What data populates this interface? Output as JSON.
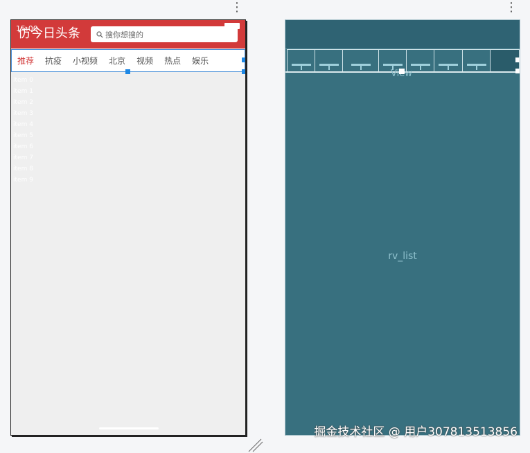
{
  "toolbar": {
    "more_icon": "more-vert-icon"
  },
  "phone": {
    "status_time": "15:00",
    "app_title": "仿今日头条",
    "search_placeholder": "搜你想搜的",
    "search_icon": "search-icon",
    "colors": {
      "header": "#d23a3a",
      "background": "#efefef",
      "selection": "#1e88e5"
    },
    "tabs": [
      {
        "label": "推荐",
        "active": true
      },
      {
        "label": "抗疫",
        "active": false
      },
      {
        "label": "小视频",
        "active": false
      },
      {
        "label": "北京",
        "active": false
      },
      {
        "label": "视频",
        "active": false
      },
      {
        "label": "热点",
        "active": false
      },
      {
        "label": "娱乐",
        "active": false
      }
    ],
    "list_items": [
      "item 0",
      "item 1",
      "item 2",
      "item 3",
      "item 4",
      "item 5",
      "item 6",
      "item 7",
      "item 8",
      "item 9"
    ]
  },
  "blueprint": {
    "view_label": "View",
    "rv_label": "rv_list",
    "colors": {
      "background": "#38707f"
    }
  },
  "watermark": "掘金技术社区 @ 用户307813513856"
}
